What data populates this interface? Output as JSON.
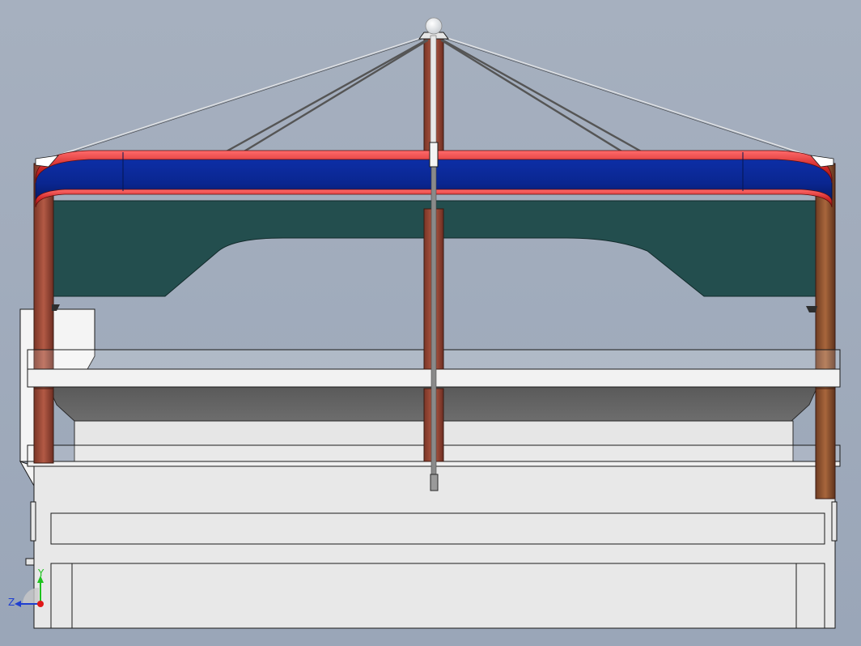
{
  "viewport": {
    "title": "",
    "background_colors": [
      "#a6b0bf",
      "#9aa6b8"
    ]
  },
  "model": {
    "parts": [
      {
        "name": "mast",
        "color": "#9b4a3a"
      },
      {
        "name": "stay-cables",
        "color": "#6a6a6a"
      },
      {
        "name": "roof-frame",
        "color": "#0b2a9c"
      },
      {
        "name": "roof-frame-trim",
        "color": "#cc2b2b"
      },
      {
        "name": "canopy",
        "color": "#234e4e"
      },
      {
        "name": "upper-deck",
        "color": "#f0f0f0"
      },
      {
        "name": "deck-underside",
        "color": "#626262"
      },
      {
        "name": "glass-railing",
        "color": "#cfd4da"
      },
      {
        "name": "lower-hull",
        "color": "#e8e8e8"
      },
      {
        "name": "side-posts",
        "color": "#8a5030"
      }
    ]
  },
  "triad": {
    "y_label": "Y",
    "z_label": "Z",
    "colors": {
      "y": "#1ec21e",
      "z": "#1f3fd0",
      "x": "#e01818"
    }
  }
}
